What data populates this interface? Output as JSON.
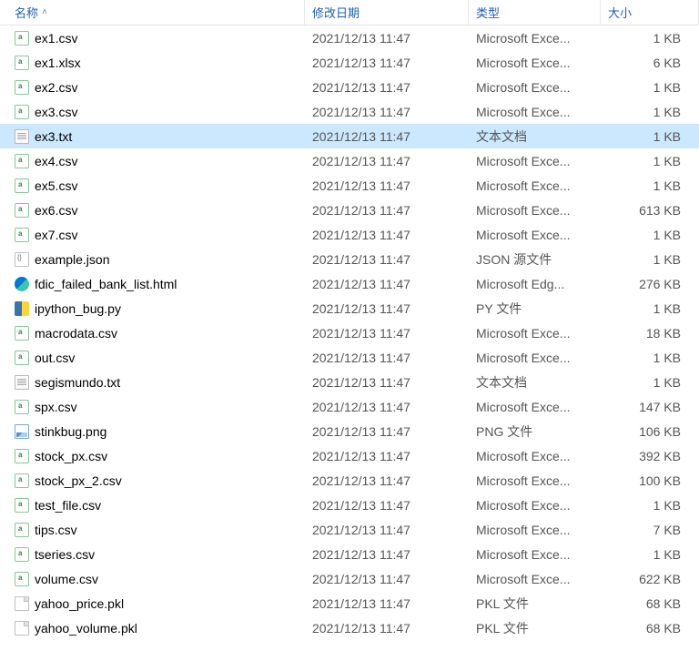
{
  "headers": {
    "name": "名称",
    "date": "修改日期",
    "type": "类型",
    "size": "大小"
  },
  "files": [
    {
      "name": "ex1.csv",
      "date": "2021/12/13 11:47",
      "type": "Microsoft Exce...",
      "size": "1 KB",
      "icon": "excel",
      "selected": false
    },
    {
      "name": "ex1.xlsx",
      "date": "2021/12/13 11:47",
      "type": "Microsoft Exce...",
      "size": "6 KB",
      "icon": "excel",
      "selected": false
    },
    {
      "name": "ex2.csv",
      "date": "2021/12/13 11:47",
      "type": "Microsoft Exce...",
      "size": "1 KB",
      "icon": "excel",
      "selected": false
    },
    {
      "name": "ex3.csv",
      "date": "2021/12/13 11:47",
      "type": "Microsoft Exce...",
      "size": "1 KB",
      "icon": "excel",
      "selected": false
    },
    {
      "name": "ex3.txt",
      "date": "2021/12/13 11:47",
      "type": "文本文档",
      "size": "1 KB",
      "icon": "txt",
      "selected": true
    },
    {
      "name": "ex4.csv",
      "date": "2021/12/13 11:47",
      "type": "Microsoft Exce...",
      "size": "1 KB",
      "icon": "excel",
      "selected": false
    },
    {
      "name": "ex5.csv",
      "date": "2021/12/13 11:47",
      "type": "Microsoft Exce...",
      "size": "1 KB",
      "icon": "excel",
      "selected": false
    },
    {
      "name": "ex6.csv",
      "date": "2021/12/13 11:47",
      "type": "Microsoft Exce...",
      "size": "613 KB",
      "icon": "excel",
      "selected": false
    },
    {
      "name": "ex7.csv",
      "date": "2021/12/13 11:47",
      "type": "Microsoft Exce...",
      "size": "1 KB",
      "icon": "excel",
      "selected": false
    },
    {
      "name": "example.json",
      "date": "2021/12/13 11:47",
      "type": "JSON 源文件",
      "size": "1 KB",
      "icon": "json",
      "selected": false
    },
    {
      "name": "fdic_failed_bank_list.html",
      "date": "2021/12/13 11:47",
      "type": "Microsoft Edg...",
      "size": "276 KB",
      "icon": "edge",
      "selected": false
    },
    {
      "name": "ipython_bug.py",
      "date": "2021/12/13 11:47",
      "type": "PY 文件",
      "size": "1 KB",
      "icon": "py",
      "selected": false
    },
    {
      "name": "macrodata.csv",
      "date": "2021/12/13 11:47",
      "type": "Microsoft Exce...",
      "size": "18 KB",
      "icon": "excel",
      "selected": false
    },
    {
      "name": "out.csv",
      "date": "2021/12/13 11:47",
      "type": "Microsoft Exce...",
      "size": "1 KB",
      "icon": "excel",
      "selected": false
    },
    {
      "name": "segismundo.txt",
      "date": "2021/12/13 11:47",
      "type": "文本文档",
      "size": "1 KB",
      "icon": "txt",
      "selected": false
    },
    {
      "name": "spx.csv",
      "date": "2021/12/13 11:47",
      "type": "Microsoft Exce...",
      "size": "147 KB",
      "icon": "excel",
      "selected": false
    },
    {
      "name": "stinkbug.png",
      "date": "2021/12/13 11:47",
      "type": "PNG 文件",
      "size": "106 KB",
      "icon": "png",
      "selected": false
    },
    {
      "name": "stock_px.csv",
      "date": "2021/12/13 11:47",
      "type": "Microsoft Exce...",
      "size": "392 KB",
      "icon": "excel",
      "selected": false
    },
    {
      "name": "stock_px_2.csv",
      "date": "2021/12/13 11:47",
      "type": "Microsoft Exce...",
      "size": "100 KB",
      "icon": "excel",
      "selected": false
    },
    {
      "name": "test_file.csv",
      "date": "2021/12/13 11:47",
      "type": "Microsoft Exce...",
      "size": "1 KB",
      "icon": "excel",
      "selected": false
    },
    {
      "name": "tips.csv",
      "date": "2021/12/13 11:47",
      "type": "Microsoft Exce...",
      "size": "7 KB",
      "icon": "excel",
      "selected": false
    },
    {
      "name": "tseries.csv",
      "date": "2021/12/13 11:47",
      "type": "Microsoft Exce...",
      "size": "1 KB",
      "icon": "excel",
      "selected": false
    },
    {
      "name": "volume.csv",
      "date": "2021/12/13 11:47",
      "type": "Microsoft Exce...",
      "size": "622 KB",
      "icon": "excel",
      "selected": false
    },
    {
      "name": "yahoo_price.pkl",
      "date": "2021/12/13 11:47",
      "type": "PKL 文件",
      "size": "68 KB",
      "icon": "pkl",
      "selected": false
    },
    {
      "name": "yahoo_volume.pkl",
      "date": "2021/12/13 11:47",
      "type": "PKL 文件",
      "size": "68 KB",
      "icon": "pkl",
      "selected": false
    }
  ]
}
